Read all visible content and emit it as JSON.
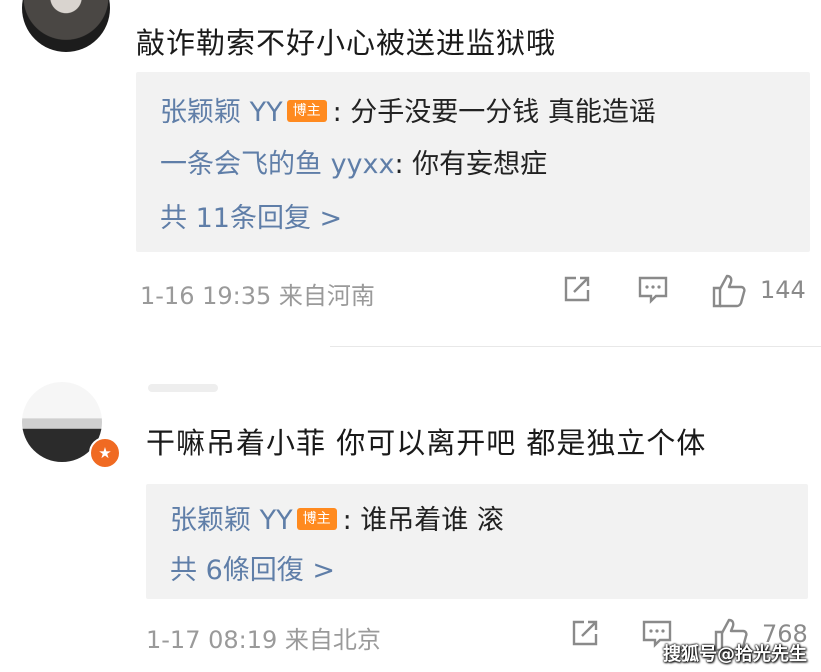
{
  "comments": [
    {
      "text": "敲诈勒索不好小心被送进监狱哦",
      "replies": [
        {
          "user": "张颖颖 YY",
          "tag": "博主",
          "text": ": 分手没要一分钱 真能造谣"
        },
        {
          "user": "一条会飞的鱼 yyxx",
          "text": ": 你有妄想症"
        }
      ],
      "more": "共 11条回复 >",
      "time": "1-16 19:35",
      "location": "来自河南",
      "likes": "144"
    },
    {
      "badge_icon": "star-icon",
      "text": "干嘛吊着小菲 你可以离开吧 都是独立个体",
      "replies": [
        {
          "user": "张颖颖 YY",
          "tag": "博主",
          "text": ": 谁吊着谁 滚"
        }
      ],
      "more": "共 6條回復 >",
      "time": "1-17 08:19",
      "location": "来自北京",
      "likes": "768"
    }
  ],
  "watermark": "搜狐号@拾光先生",
  "colors": {
    "username": "#5f7ea8",
    "tag": "#ff8a1f",
    "badge": "#f06a22",
    "reply_bg": "#f2f2f2",
    "meta": "#9a9a9a"
  }
}
